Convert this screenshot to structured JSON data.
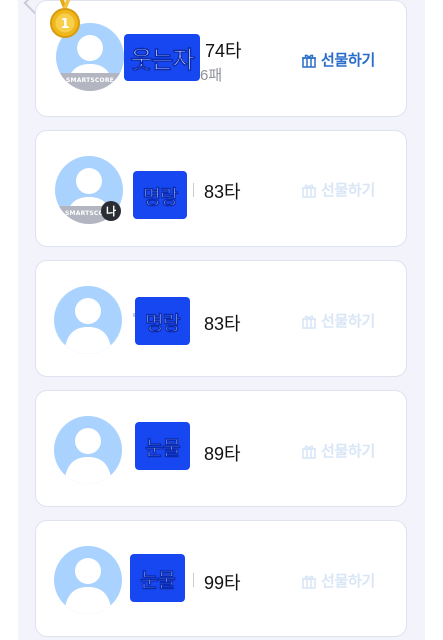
{
  "colors": {
    "emoji_badge": "#1747f0",
    "gift_active": "#2a6cc9",
    "gift_disabled": "#d9e6f6",
    "avatar_bg": "#a9d2ff",
    "panel_bg": "#f2f3fb",
    "medal": "#f0b71c"
  },
  "icons": {
    "back": "chevron-left-icon",
    "gift": "gift-icon",
    "medal": "gold-medal-icon"
  },
  "ranking": [
    {
      "rank_badge": "1",
      "avatar_brand": "SMARTSCORE",
      "emoji_label": "웃는자",
      "strokes": "74타",
      "sub": "6패",
      "gift_label": "선물하기",
      "gift_enabled": true,
      "is_me": false
    },
    {
      "avatar_brand": "SMARTSCORE",
      "me_badge": "나",
      "emoji_label": "명랑",
      "strokes": "83타",
      "gift_label": "선물하기",
      "gift_enabled": false,
      "is_me": true
    },
    {
      "emoji_label": "명랑",
      "strokes": "83타",
      "gift_label": "선물하기",
      "gift_enabled": false,
      "is_me": false
    },
    {
      "emoji_label": "눈물",
      "strokes": "89타",
      "gift_label": "선물하기",
      "gift_enabled": false,
      "is_me": false
    },
    {
      "emoji_label": "눈물",
      "strokes": "99타",
      "gift_label": "선물하기",
      "gift_enabled": false,
      "is_me": false
    }
  ]
}
